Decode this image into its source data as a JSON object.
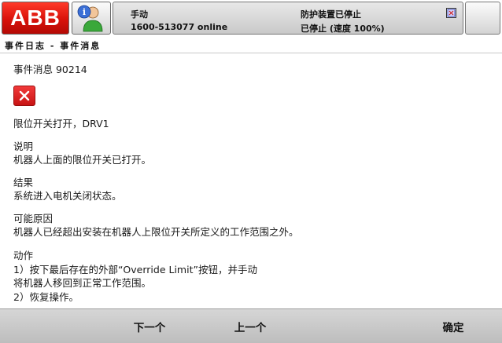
{
  "header": {
    "logo_text": "ABB",
    "mode": "手动",
    "controller": "1600-513077 online",
    "state": "防护装置已停止",
    "speed": "已停止 (速度 100%)"
  },
  "title": "事件日志 - 事件消息",
  "message": {
    "event_number": "事件消息 90214",
    "headline": "限位开关打开，DRV1",
    "description_label": "说明",
    "description": "机器人上面的限位开关已打开。",
    "consequence_label": "结果",
    "consequence": "系统进入电机关闭状态。",
    "causes_label": "可能原因",
    "causes": "机器人已经超出安装在机器人上限位开关所定义的工作范围之外。",
    "actions_label": "动作",
    "action_lines": [
      "1）按下最后存在的外部“Override Limit”按钮，并手动",
      "将机器人移回到正常工作范围。",
      "2）恢复操作。"
    ]
  },
  "footer": {
    "next_label": "下一个",
    "prev_label": "上一个",
    "ok_label": "确定"
  },
  "colors": {
    "abb_red": "#d8120a",
    "error_red": "#c81414",
    "bar_gray": "#c9c9c9"
  }
}
